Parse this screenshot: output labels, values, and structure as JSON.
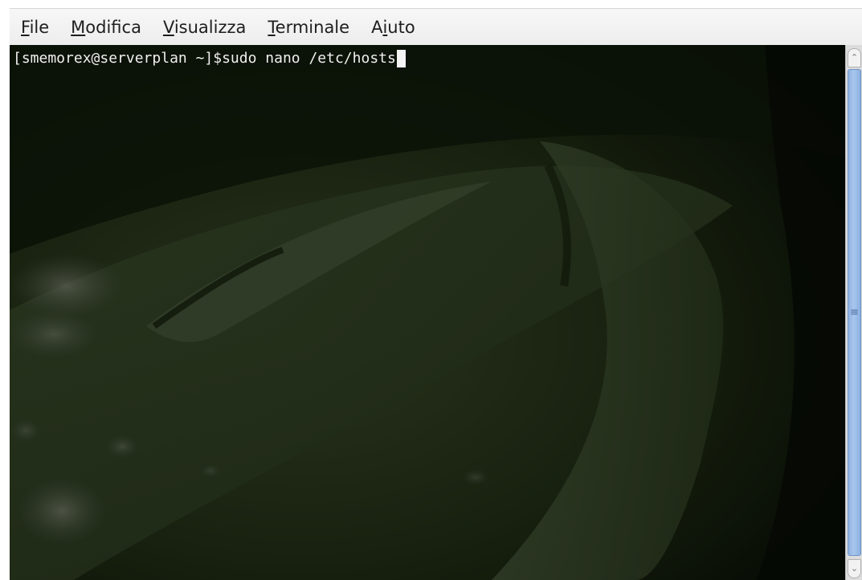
{
  "menubar": {
    "items": [
      {
        "mnemonic": "F",
        "rest": "ile"
      },
      {
        "mnemonic": "M",
        "rest": "odifica"
      },
      {
        "mnemonic": "V",
        "rest": "isualizza"
      },
      {
        "mnemonic": "T",
        "rest": "erminale"
      },
      {
        "pre": "A",
        "mnemonic": "i",
        "rest": "uto"
      }
    ]
  },
  "terminal": {
    "prompt": "[smemorex@serverplan ~]$",
    "command": "sudo nano /etc/hosts"
  },
  "scrollbar": {
    "up_icon": "scroll-up-arrow-icon",
    "down_icon": "scroll-down-arrow-icon",
    "grip_icon": "grip-icon",
    "up_glyph": "⌃",
    "down_glyph": "⌄",
    "grip_glyph": "≡",
    "position_fraction": 0.0
  },
  "colors": {
    "terminal_text": "#f0f0f0",
    "thumb": "#a9c6ee"
  }
}
